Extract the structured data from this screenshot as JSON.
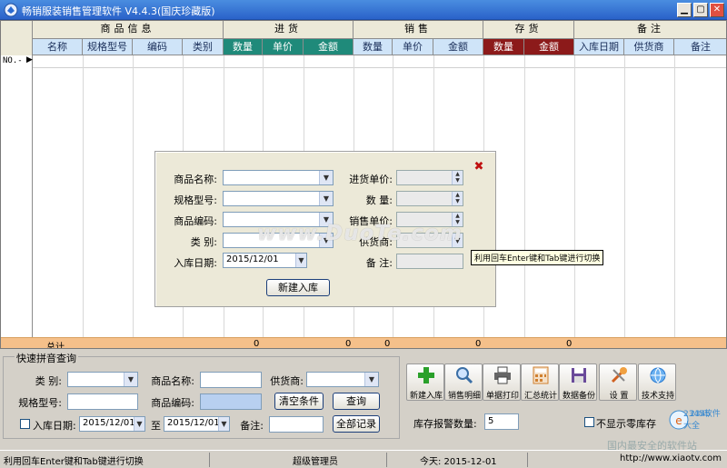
{
  "window": {
    "title": "畅销服装销售管理软件 V4.4.3(国庆珍藏版)"
  },
  "grid": {
    "groups": [
      "商品信息",
      "进货",
      "销售",
      "存货",
      "备注"
    ],
    "columns": [
      "名称",
      "规格型号",
      "编码",
      "类别",
      "数量",
      "单价",
      "金额",
      "数量",
      "单价",
      "金额",
      "数量",
      "金额",
      "入库日期",
      "供货商",
      "备注"
    ],
    "row_label": "NO.-",
    "totals_label": "总计",
    "totals_values": [
      "0",
      "0",
      "0",
      "0",
      "0"
    ]
  },
  "dialog": {
    "fields": {
      "product_name": "商品名称:",
      "spec": "规格型号:",
      "code": "商品编码:",
      "category": "类  别:",
      "in_date": "入库日期:",
      "in_price": "进货单价:",
      "quantity": "数  量:",
      "sale_price": "销售单价:",
      "supplier": "供货商:",
      "remark": "备  注:"
    },
    "date_value": "2015/12/01",
    "button": "新建入库",
    "close_icon": "close-x-icon"
  },
  "watermark": "www.DuoTe.com",
  "tooltip": "利用回车Enter键和Tab键进行切换",
  "query": {
    "title": "快速拼音查询",
    "category": "类 别:",
    "product_name": "商品名称:",
    "supplier": "供货商:",
    "spec": "规格型号:",
    "code": "商品编码:",
    "clear": "清空条件",
    "search": "查询",
    "in_date": "入库日期:",
    "date_from": "2015/12/01",
    "to": "至",
    "date_to": "2015/12/01",
    "remark": "备注:",
    "all": "全部记录"
  },
  "toolbar": [
    {
      "label": "新建入库",
      "icon": "add-plus-icon",
      "color": "#2aa02a"
    },
    {
      "label": "销售明细",
      "icon": "magnifier-icon",
      "color": "#3a6ea5"
    },
    {
      "label": "单据打印",
      "icon": "printer-icon",
      "color": "#444444"
    },
    {
      "label": "汇总统计",
      "icon": "calculator-icon",
      "color": "#d08030"
    },
    {
      "label": "数据备份",
      "icon": "floppy-disk-icon",
      "color": "#6a4a9a"
    },
    {
      "label": "设  置",
      "icon": "tools-icon",
      "color": "#d06020"
    },
    {
      "label": "技术支持",
      "icon": "globe-support-icon",
      "color": "#2a7ad0"
    }
  ],
  "stock": {
    "label": "库存报警数量:",
    "value": "5",
    "hide_label": "不显示零库存"
  },
  "status": {
    "hint": "利用回车Enter键和Tab键进行切换",
    "user": "超级管理员",
    "today": "今天: 2015-12-01",
    "url": "http://www.xiaotv.com"
  },
  "brand": {
    "logo_text": "2345软件大全",
    "slogan": "国内最安全的软件站"
  }
}
